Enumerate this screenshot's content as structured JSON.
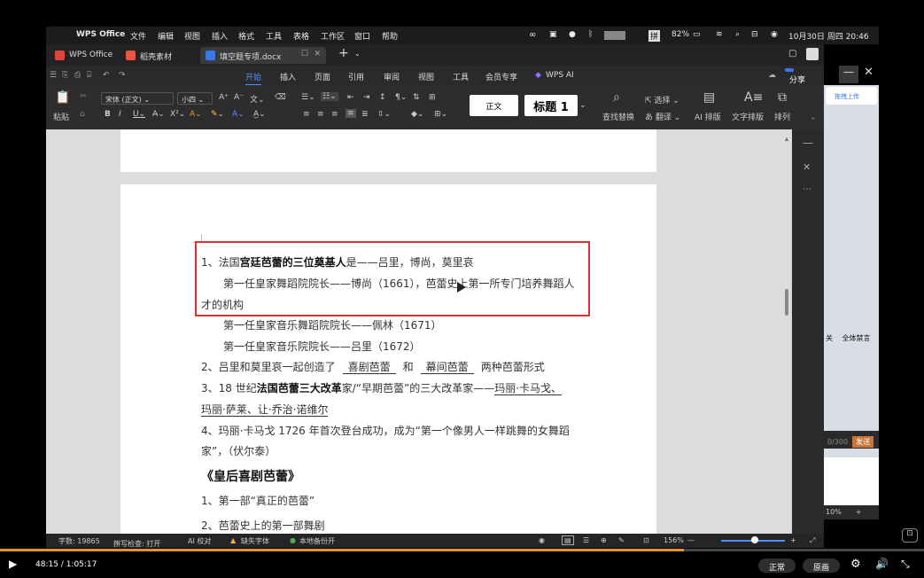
{
  "menubar": {
    "app_name": "WPS Office",
    "items": [
      "文件",
      "编辑",
      "视图",
      "插入",
      "格式",
      "工具",
      "表格",
      "工作区",
      "窗口",
      "帮助"
    ],
    "battery": "82%",
    "datetime": "10月30日 周四  20:46",
    "input_method": "拼"
  },
  "tabs": [
    {
      "label": "WPS Office"
    },
    {
      "label": "稻壳素材"
    },
    {
      "label": "填空题专项.docx"
    }
  ],
  "ribbon_tabs": [
    "开始",
    "插入",
    "页面",
    "引用",
    "审阅",
    "视图",
    "工具",
    "会员专享",
    "WPS AI"
  ],
  "share_label": "分享",
  "ribbon": {
    "paste_label": "粘贴",
    "font_name": "宋体 (正文)",
    "font_size": "小四",
    "style_normal": "正文",
    "style_heading": "标题 1",
    "find_replace": "查找替换",
    "select": "选择",
    "translate": "翻译",
    "ai_layout": "AI 排版",
    "text_layout": "文字排版",
    "arrange": "排列"
  },
  "overlay": {
    "upload_label": "拖拽上传",
    "mute_label": "关",
    "ban_label": "全体禁言",
    "counter": "0/300",
    "send_label": "发送",
    "zoom_pct": "10%"
  },
  "document": {
    "lines": [
      {
        "pre": "1、法国",
        "bold": "宫廷芭蕾的三位奠基人",
        "post": "是——吕里，博尚，莫里哀"
      },
      {
        "text": "第一任皇家舞蹈院院长——博尚（1661），芭蕾史上第一所专门培养舞蹈人"
      },
      {
        "text": "才的机构"
      },
      {
        "text": "第一任皇家音乐舞蹈院院长——佩林（1671）"
      },
      {
        "text": "第一任皇家音乐院院长——吕里（1672）"
      },
      {
        "pre": "2、吕里和莫里哀一起创造了",
        "u1": "喜剧芭蕾",
        "mid": "和",
        "u2": "幕间芭蕾",
        "post": "两种芭蕾形式"
      },
      {
        "pre": "3、18 世纪",
        "bold": "法国芭蕾三大改革",
        "post": "家/“早期芭蕾”的三大改革家——",
        "u1": "玛丽·卡马戈、"
      },
      {
        "u1": "玛丽·萨莱、让·乔治·诺维尔"
      },
      {
        "text": "4、玛丽·卡马戈 1726 年首次登台成功，成为“第一个像男人一样跳舞的女舞蹈"
      },
      {
        "text": "家”，（伏尔泰）"
      },
      {
        "heading": "《皇后喜剧芭蕾》"
      },
      {
        "text": "1、第一部“真正的芭蕾”"
      },
      {
        "text": "2、芭蕾史上的第一部舞剧"
      }
    ]
  },
  "statusbar": {
    "word_count": "字数: 19865",
    "spellcheck": "拼写检查: 打开",
    "ai_proofread": "AI 校对",
    "missing_font": "缺失字体",
    "backup": "本地备份开",
    "zoom": "156%"
  },
  "video": {
    "time": "48:15 / 1:05:17",
    "progress": 0.739,
    "speed_label": "正常",
    "quality_label": "原画"
  }
}
